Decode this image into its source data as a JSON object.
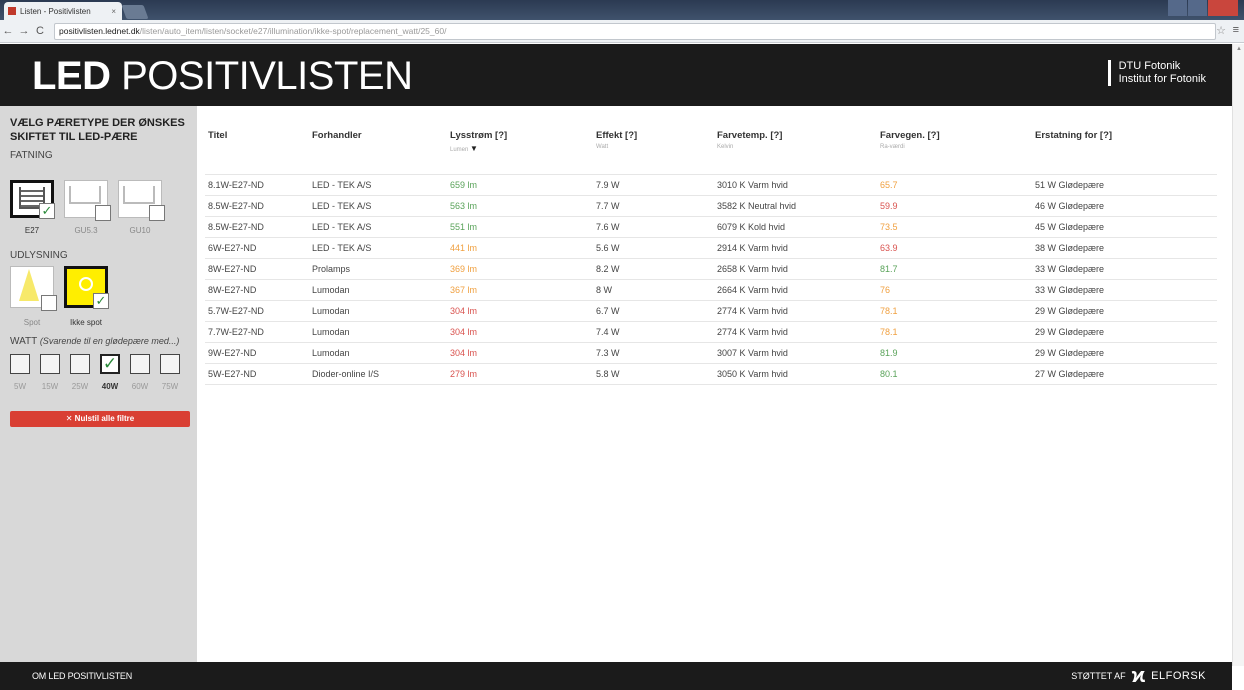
{
  "browser": {
    "tab_title": "Listen - Positivlisten",
    "tab_close": "×",
    "url_host": "positivlisten.lednet.dk",
    "url_path": "/listen/auto_item/listen/socket/e27/illumination/ikke-spot/replacement_watt/25_60/"
  },
  "header": {
    "logo_bold": "LED",
    "logo_rest": " POSITIVLISTEN",
    "dtu_line1": "DTU Fotonik",
    "dtu_line2": "Institut for Fotonik"
  },
  "sidebar": {
    "title": "Vælg pæretype der ønskes skiftet til LED-pære",
    "fatning_label": "Fatning",
    "fatning": [
      "E27",
      "GU5.3",
      "GU10"
    ],
    "udlysning_label": "Udlysning",
    "udlysning": [
      "Spot",
      "Ikke spot"
    ],
    "watt_label": "Watt",
    "watt_hint": "(Svarende til en glødepære med...)",
    "watt": [
      "5W",
      "15W",
      "25W",
      "40W",
      "60W",
      "75W"
    ],
    "reset": "✕ Nulstil alle filtre"
  },
  "table": {
    "headers": [
      {
        "label": "Titel",
        "sub": ""
      },
      {
        "label": "Forhandler",
        "sub": ""
      },
      {
        "label": "Lysstrøm [?]",
        "sub": "Lumen"
      },
      {
        "label": "Effekt [?]",
        "sub": "Watt"
      },
      {
        "label": "Farvetemp. [?]",
        "sub": "Kelvin"
      },
      {
        "label": "Farvegen. [?]",
        "sub": "Ra-værdi"
      },
      {
        "label": "Erstatning for [?]",
        "sub": ""
      }
    ],
    "sort_arrow": "▼",
    "rows": [
      {
        "titel": "8.1W-E27-ND",
        "forhandler": "LED - TEK A/S",
        "lys": "659 lm",
        "lys_c": "green",
        "effekt": "7.9 W",
        "temp": "3010 K Varm hvid",
        "ra": "65.7",
        "ra_c": "orange",
        "erst": "51 W Glødepære"
      },
      {
        "titel": "8.5W-E27-ND",
        "forhandler": "LED - TEK A/S",
        "lys": "563 lm",
        "lys_c": "green",
        "effekt": "7.7 W",
        "temp": "3582 K Neutral hvid",
        "ra": "59.9",
        "ra_c": "red",
        "erst": "46 W Glødepære"
      },
      {
        "titel": "8.5W-E27-ND",
        "forhandler": "LED - TEK A/S",
        "lys": "551 lm",
        "lys_c": "green",
        "effekt": "7.6 W",
        "temp": "6079 K Kold hvid",
        "ra": "73.5",
        "ra_c": "orange",
        "erst": "45 W Glødepære"
      },
      {
        "titel": "6W-E27-ND",
        "forhandler": "LED - TEK A/S",
        "lys": "441 lm",
        "lys_c": "orange",
        "effekt": "5.6 W",
        "temp": "2914 K Varm hvid",
        "ra": "63.9",
        "ra_c": "red",
        "erst": "38 W Glødepære"
      },
      {
        "titel": "8W-E27-ND",
        "forhandler": "Prolamps",
        "lys": "369 lm",
        "lys_c": "orange",
        "effekt": "8.2 W",
        "temp": "2658 K Varm hvid",
        "ra": "81.7",
        "ra_c": "green",
        "erst": "33 W Glødepære"
      },
      {
        "titel": "8W-E27-ND",
        "forhandler": "Lumodan",
        "lys": "367 lm",
        "lys_c": "orange",
        "effekt": "8 W",
        "temp": "2664 K Varm hvid",
        "ra": "76",
        "ra_c": "orange",
        "erst": "33 W Glødepære"
      },
      {
        "titel": "5.7W-E27-ND",
        "forhandler": "Lumodan",
        "lys": "304 lm",
        "lys_c": "red",
        "effekt": "6.7 W",
        "temp": "2774 K Varm hvid",
        "ra": "78.1",
        "ra_c": "orange",
        "erst": "29 W Glødepære"
      },
      {
        "titel": "7.7W-E27-ND",
        "forhandler": "Lumodan",
        "lys": "304 lm",
        "lys_c": "red",
        "effekt": "7.4 W",
        "temp": "2774 K Varm hvid",
        "ra": "78.1",
        "ra_c": "orange",
        "erst": "29 W Glødepære"
      },
      {
        "titel": "9W-E27-ND",
        "forhandler": "Lumodan",
        "lys": "304 lm",
        "lys_c": "red",
        "effekt": "7.3 W",
        "temp": "3007 K Varm hvid",
        "ra": "81.9",
        "ra_c": "green",
        "erst": "29 W Glødepære"
      },
      {
        "titel": "5W-E27-ND",
        "forhandler": "Dioder-online I/S",
        "lys": "279 lm",
        "lys_c": "red",
        "effekt": "5.8 W",
        "temp": "3050 K Varm hvid",
        "ra": "80.1",
        "ra_c": "green",
        "erst": "27 W Glødepære"
      }
    ]
  },
  "footer": {
    "link": "OM LED POSITIVLISTEN",
    "sponsor_label": "STØTTET AF",
    "sponsor_name": "ELFORSK"
  },
  "colors": {
    "green": "#5aa35a",
    "orange": "#f0a040",
    "red": "#d9534f",
    "accent": "#d93f33",
    "header_bg": "#1b1b1b",
    "yellow": "#ffee00"
  }
}
